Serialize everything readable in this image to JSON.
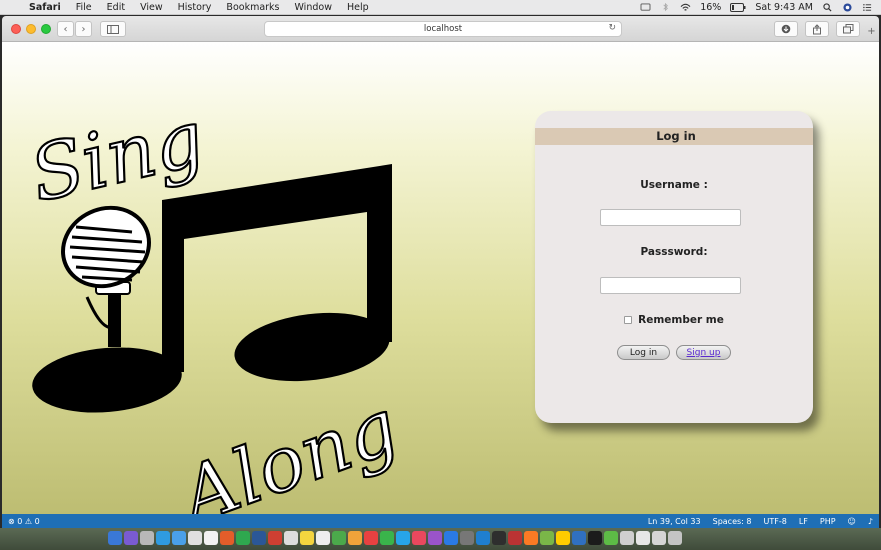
{
  "menubar": {
    "app": "Safari",
    "items": [
      "File",
      "Edit",
      "View",
      "History",
      "Bookmarks",
      "Window",
      "Help"
    ],
    "battery": "16%",
    "clock": "Sat 9:43 AM"
  },
  "browser": {
    "url": "localhost"
  },
  "logo": {
    "word1": "Sing",
    "word2": "Along"
  },
  "login": {
    "title": "Log in",
    "username_label": "Username :",
    "username_value": "",
    "password_label": "Passsword:",
    "password_value": "",
    "remember_label": "Remember me",
    "login_button": "Log in",
    "signup_link": "Sign up"
  },
  "statusbar": {
    "left": "⊗ 0 ⚠ 0",
    "position": "Ln 39, Col 33",
    "spaces": "Spaces: 8",
    "encoding": "UTF-8",
    "eol": "LF",
    "language": "PHP"
  },
  "colors": {
    "card_header": "#dac9b4",
    "card_bg": "#ece8e8",
    "statusbar": "#1f6fb5",
    "signup_link": "#5a2ad0"
  }
}
